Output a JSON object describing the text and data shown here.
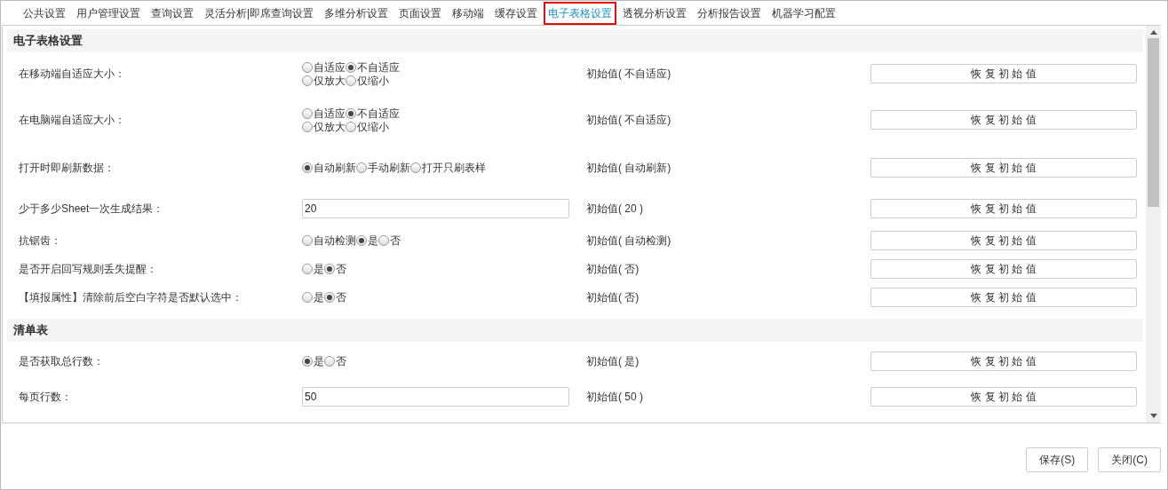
{
  "tabs": [
    {
      "label": "公共设置",
      "selected": false
    },
    {
      "label": "用户管理设置",
      "selected": false
    },
    {
      "label": "查询设置",
      "selected": false
    },
    {
      "label": "灵活分析|即席查询设置",
      "selected": false
    },
    {
      "label": "多维分析设置",
      "selected": false
    },
    {
      "label": "页面设置",
      "selected": false
    },
    {
      "label": "移动端",
      "selected": false
    },
    {
      "label": "缓存设置",
      "selected": false
    },
    {
      "label": "电子表格设置",
      "selected": true
    },
    {
      "label": "透视分析设置",
      "selected": false
    },
    {
      "label": "分析报告设置",
      "selected": false
    },
    {
      "label": "机器学习配置",
      "selected": false
    }
  ],
  "sections": [
    {
      "title": "电子表格设置",
      "rows": [
        {
          "label": "在移动端自适应大小：",
          "kind": "radio",
          "option_rows": [
            [
              {
                "label": "自适应",
                "selected": false
              },
              {
                "label": "不自适应",
                "selected": true
              }
            ],
            [
              {
                "label": "仅放大",
                "selected": false
              },
              {
                "label": "仅缩小",
                "selected": false
              }
            ]
          ],
          "initial": "初始值( 不自适应)",
          "reset": "恢 复 初 始 值"
        },
        {
          "label": "在电脑端自适应大小：",
          "kind": "radio",
          "option_rows": [
            [
              {
                "label": "自适应",
                "selected": false
              },
              {
                "label": "不自适应",
                "selected": true
              }
            ],
            [
              {
                "label": "仅放大",
                "selected": false
              },
              {
                "label": "仅缩小",
                "selected": false
              }
            ]
          ],
          "initial": "初始值( 不自适应)",
          "reset": "恢 复 初 始 值"
        },
        {
          "label": "打开时即刷新数据：",
          "kind": "radio",
          "option_rows": [
            [
              {
                "label": "自动刷新",
                "selected": true
              },
              {
                "label": "手动刷新",
                "selected": false
              },
              {
                "label": "打开只刷表样",
                "selected": false
              }
            ]
          ],
          "initial": "初始值( 自动刷新)",
          "reset": "恢 复 初 始 值"
        },
        {
          "label": "少于多少Sheet一次生成结果：",
          "kind": "text",
          "value": "20",
          "initial": "初始值( 20 )",
          "reset": "恢 复 初 始 值"
        },
        {
          "label": "抗锯齿：",
          "kind": "radio",
          "option_rows": [
            [
              {
                "label": "自动检测",
                "selected": false
              },
              {
                "label": "是",
                "selected": true
              },
              {
                "label": "否",
                "selected": false
              }
            ]
          ],
          "initial": "初始值( 自动检测)",
          "reset": "恢 复 初 始 值"
        },
        {
          "label": "是否开启回写规则丢失提醒：",
          "kind": "radio",
          "option_rows": [
            [
              {
                "label": "是",
                "selected": false
              },
              {
                "label": "否",
                "selected": true
              }
            ]
          ],
          "initial": "初始值( 否)",
          "reset": "恢 复 初 始 值"
        },
        {
          "label": "【填报属性】清除前后空白字符是否默认选中：",
          "kind": "radio",
          "option_rows": [
            [
              {
                "label": "是",
                "selected": false
              },
              {
                "label": "否",
                "selected": true
              }
            ]
          ],
          "initial": "初始值( 否)",
          "reset": "恢 复 初 始 值"
        }
      ]
    },
    {
      "title": "清单表",
      "rows": [
        {
          "label": "是否获取总行数：",
          "kind": "radio",
          "option_rows": [
            [
              {
                "label": "是",
                "selected": true
              },
              {
                "label": "否",
                "selected": false
              }
            ]
          ],
          "initial": "初始值( 是)",
          "reset": "恢 复 初 始 值"
        },
        {
          "label": "每页行数：",
          "kind": "text",
          "value": "50",
          "initial": "初始值( 50 )",
          "reset": "恢 复 初 始 值"
        }
      ]
    }
  ],
  "buttons": [
    "保存(S)",
    "关闭(C)"
  ]
}
